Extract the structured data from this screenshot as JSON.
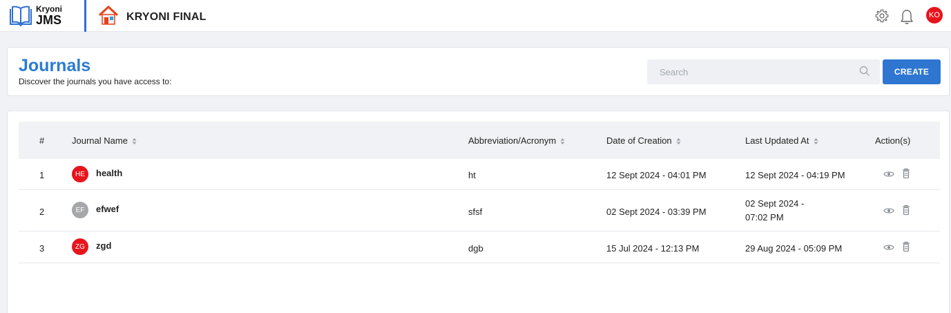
{
  "brand": {
    "line1": "Kryoni",
    "line2": "JMS"
  },
  "app": {
    "title": "KRYONI FINAL"
  },
  "user": {
    "initials": "KO",
    "avatar_color": "#e8141c"
  },
  "colors": {
    "accent": "#2f76d1",
    "title": "#2b7bd2"
  },
  "header": {
    "title": "Journals",
    "subtitle": "Discover the journals you have access to:",
    "search_placeholder": "Search",
    "create_label": "CREATE"
  },
  "table": {
    "columns": {
      "num": "#",
      "name": "Journal Name",
      "abbr": "Abbreviation/Acronym",
      "created": "Date of Creation",
      "updated": "Last Updated At",
      "actions": "Action(s)"
    },
    "rows": [
      {
        "num": "1",
        "initials": "HE",
        "badge_color": "#e8141c",
        "name": "health",
        "abbr": "ht",
        "created": "12 Sept 2024 - 04:01 PM",
        "updated": "12 Sept 2024 - 04:19 PM"
      },
      {
        "num": "2",
        "initials": "EF",
        "badge_color": "#a5a7ab",
        "name": "efwef",
        "abbr": "sfsf",
        "created": "02 Sept 2024 - 03:39 PM",
        "updated": "02 Sept 2024 - 07:02 PM"
      },
      {
        "num": "3",
        "initials": "ZG",
        "badge_color": "#e8141c",
        "name": "zgd",
        "abbr": "dgb",
        "created": "15 Jul 2024 - 12:13 PM",
        "updated": "29 Aug 2024 - 05:09 PM"
      }
    ]
  }
}
